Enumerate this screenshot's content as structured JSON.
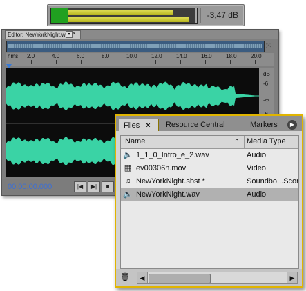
{
  "meter": {
    "level_db": "-3,47 dB",
    "colors": {
      "green": "#20a020",
      "yellow": "#d8d63a"
    }
  },
  "editor": {
    "tab_label": "Editor: NewYorkNight.wav",
    "tab_menu_icon": "menu-arrow-icon",
    "ruler": {
      "unit_label": "hms",
      "ticks": [
        "2.0",
        "4.0",
        "6.0",
        "8.0",
        "10.0",
        "12.0",
        "14.0",
        "16.0",
        "18.0",
        "20.0"
      ]
    },
    "db_scale": [
      "dB",
      "-6",
      "-∞",
      "-6",
      "dB"
    ],
    "time": "00:00:00.000",
    "transport": [
      {
        "name": "go-to-start-button",
        "glyph": "|◀"
      },
      {
        "name": "go-to-end-button",
        "glyph": "▶|"
      },
      {
        "name": "stop-button",
        "glyph": "■"
      }
    ],
    "accent_color": "#3ad3a5"
  },
  "files_panel": {
    "tabs": [
      {
        "label": "Files",
        "close": "×"
      },
      {
        "label": "Resource Central"
      },
      {
        "label": "Markers"
      }
    ],
    "columns": {
      "name": "Name",
      "media_type": "Media Type"
    },
    "rows": [
      {
        "icon": "speaker-icon",
        "glyph": "🔈",
        "name": "1_1_0_Intro_e_2.wav",
        "type": "Audio",
        "selected": false
      },
      {
        "icon": "film-icon",
        "glyph": "▦",
        "name": "ev00306n.mov",
        "type": "Video",
        "selected": false
      },
      {
        "icon": "music-note-icon",
        "glyph": "♫",
        "name": "NewYorkNight.sbst *",
        "type": "Soundbo...Scor",
        "selected": false
      },
      {
        "icon": "speaker-icon",
        "glyph": "🔈",
        "name": "NewYorkNight.wav",
        "type": "Audio",
        "selected": true
      }
    ],
    "border_color": "#e0b400"
  }
}
